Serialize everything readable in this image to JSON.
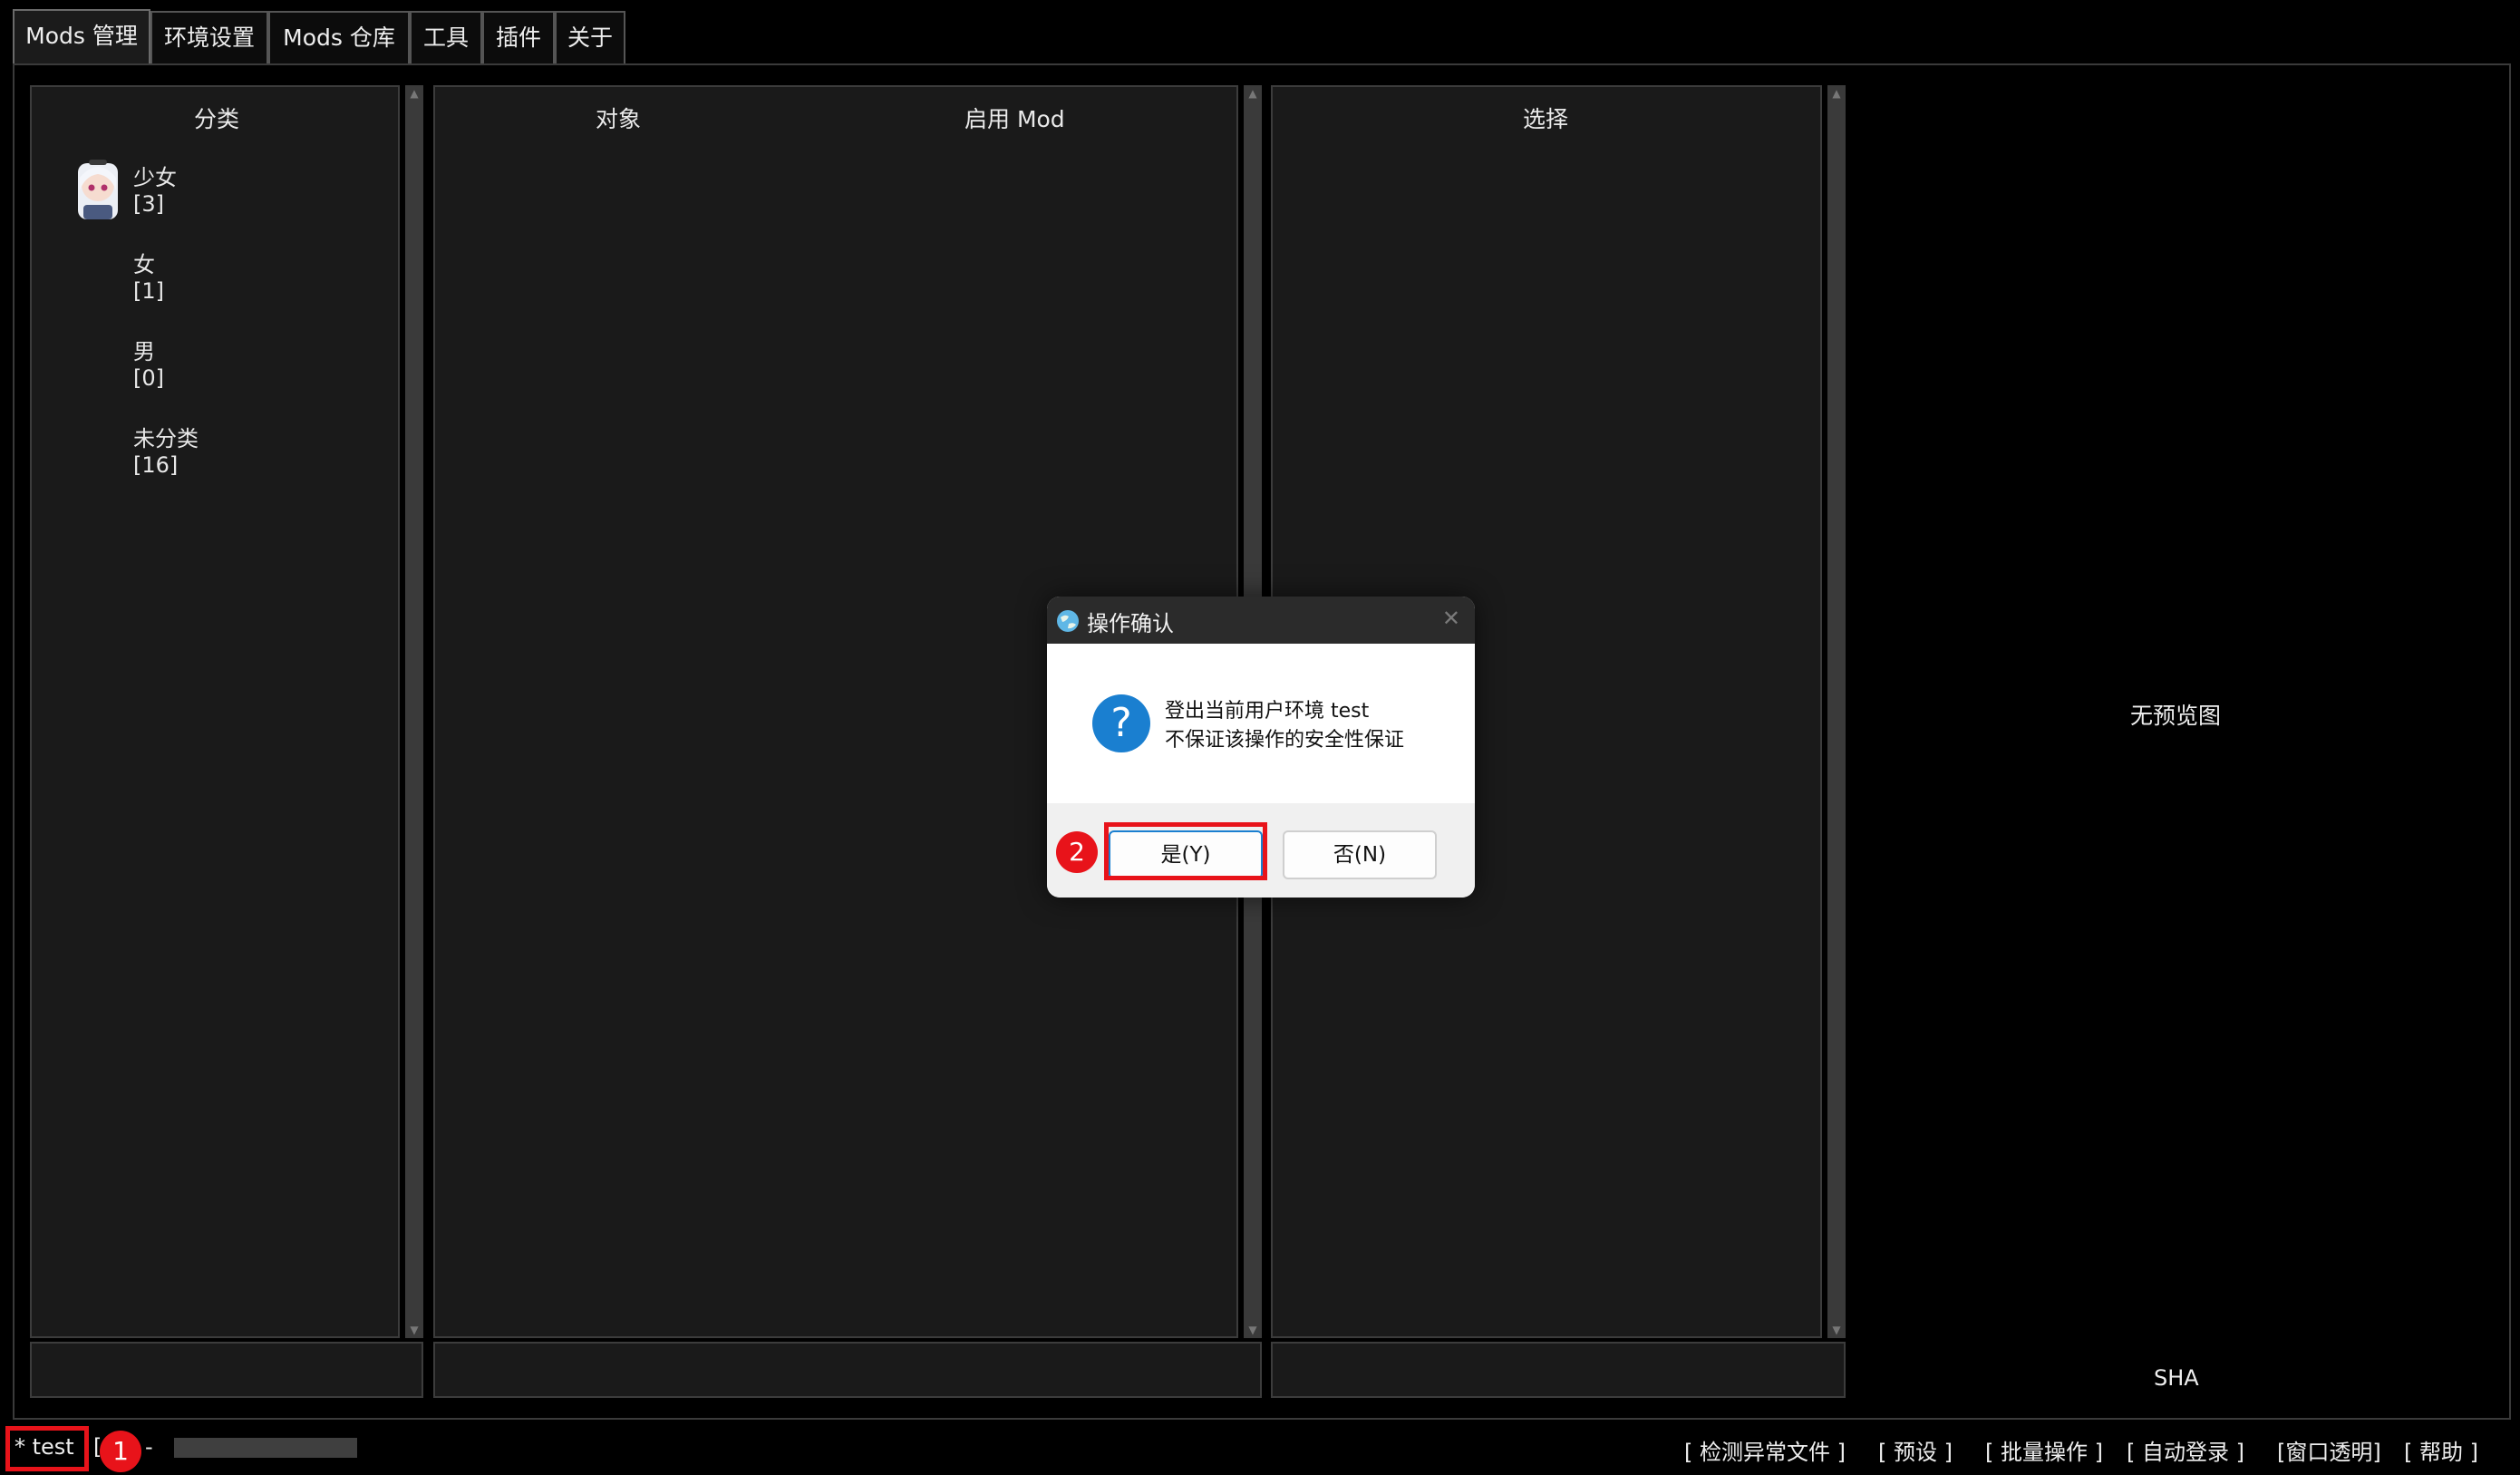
{
  "tabs": [
    {
      "label": "Mods 管理",
      "active": true
    },
    {
      "label": "环境设置"
    },
    {
      "label": "Mods 仓库"
    },
    {
      "label": "工具"
    },
    {
      "label": "插件"
    },
    {
      "label": "关于"
    }
  ],
  "categories_panel": {
    "title": "分类",
    "items": [
      {
        "name": "少女",
        "count": "[3]",
        "has_avatar": true
      },
      {
        "name": "女",
        "count": "[1]"
      },
      {
        "name": "男",
        "count": "[0]"
      },
      {
        "name": "未分类",
        "count": "[16]"
      }
    ]
  },
  "objects_panel": {
    "title_object": "对象",
    "title_enabled": "启用 Mod"
  },
  "select_panel": {
    "title": "选择"
  },
  "preview": {
    "empty_text": "无预览图",
    "sha_label": "SHA"
  },
  "dialog": {
    "title": "操作确认",
    "line1": "登出当前用户环境 test",
    "line2": "不保证该操作的安全性保证",
    "yes_label": "是(Y)",
    "no_label": "否(N)",
    "close_glyph": "✕",
    "question_glyph": "?"
  },
  "statusbar": {
    "user": "* test",
    "bracket": "[",
    "dash": "-",
    "links": [
      "[ 检测异常文件 ]",
      "[ 预设 ]",
      "[ 批量操作 ]",
      "[ 自动登录 ]",
      "[窗口透明]",
      "[ 帮助 ]"
    ]
  },
  "annotations": {
    "step1": "1",
    "step2": "2"
  },
  "colors": {
    "accent_red": "#e8131a",
    "question_blue": "#1a7fd0",
    "dialog_title_bg": "#2b2b2b"
  }
}
